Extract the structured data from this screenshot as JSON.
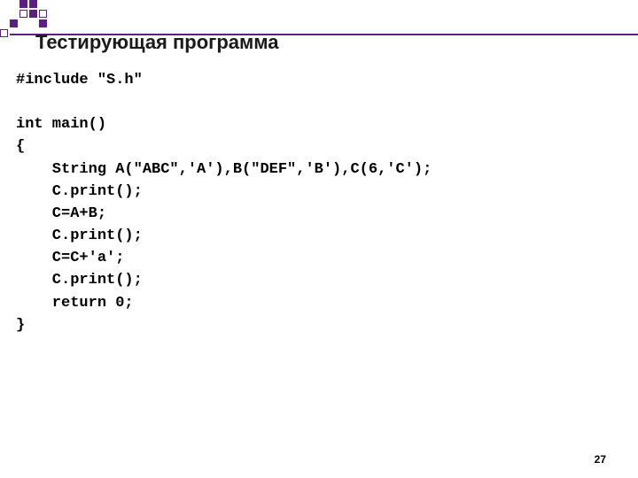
{
  "slide": {
    "title": "Тестирующая программа",
    "page_number": "27"
  },
  "code": {
    "line1": "#include \"S.h\"",
    "line2": "",
    "line3": "int main()",
    "line4": "{",
    "line5": "    String A(\"ABC\",'A'),B(\"DEF\",'B'),C(6,'C');",
    "line6": "    C.print();",
    "line7": "    C=A+B;",
    "line8": "    C.print();",
    "line9": "    С=С+'а';",
    "line10": "    C.print();",
    "line11": "    return 0;",
    "line12": "}"
  }
}
